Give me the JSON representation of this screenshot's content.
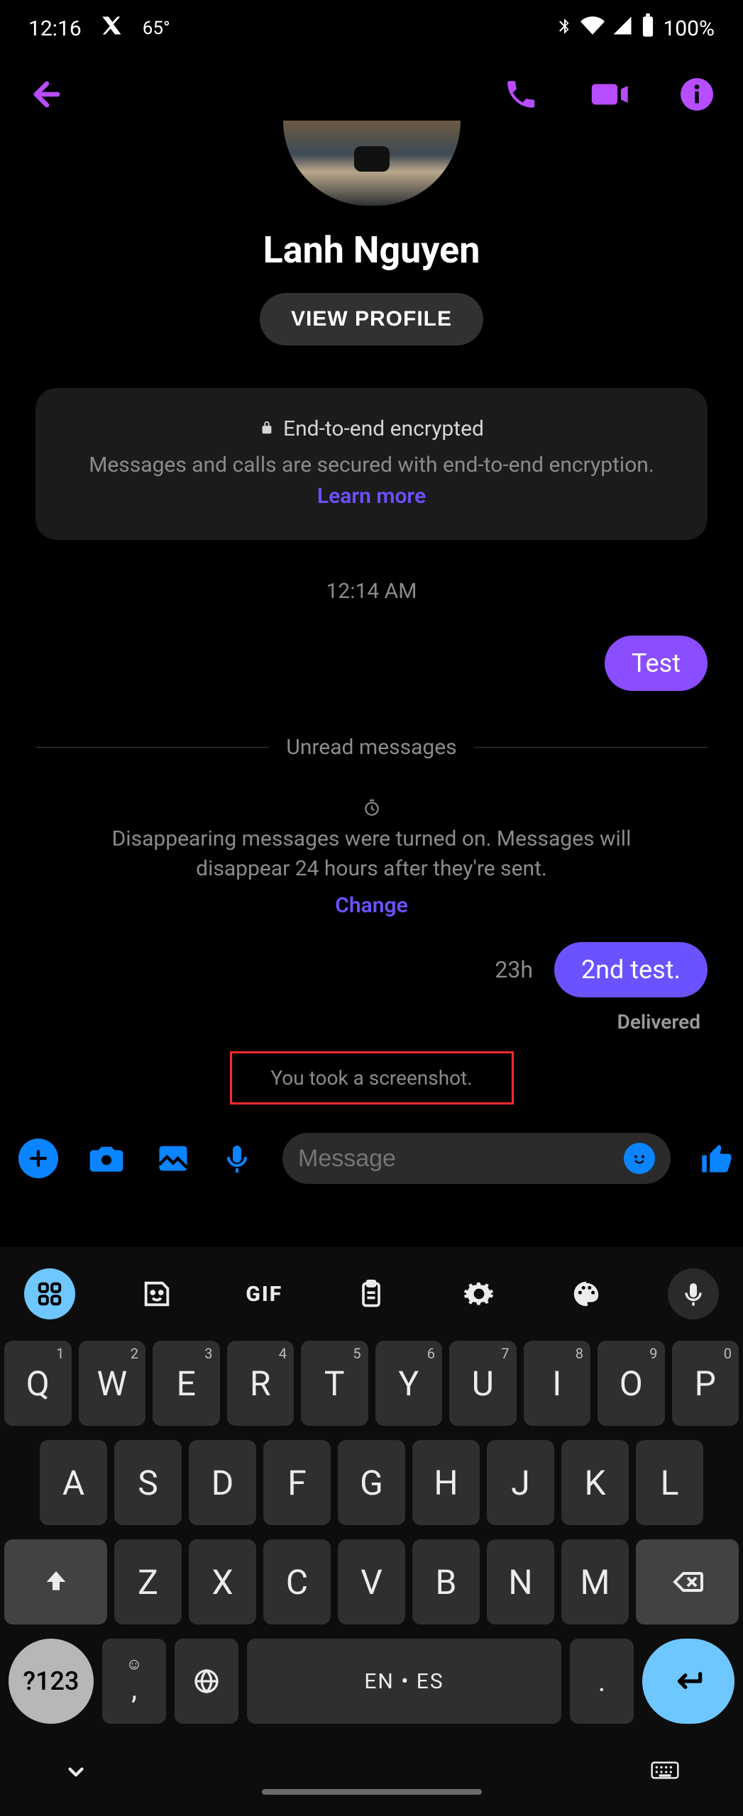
{
  "status": {
    "time": "12:16",
    "temp": "65°",
    "battery": "100%"
  },
  "chat": {
    "contact_name": "Lanh Nguyen",
    "view_profile": "VIEW PROFILE",
    "encrypt_title": "End-to-end encrypted",
    "encrypt_sub_before": "Messages and calls are secured with end-to-end encryption. ",
    "learn_more": "Learn more",
    "timestamp": "12:14 AM",
    "msg1": "Test",
    "unread_label": "Unread messages",
    "disappearing_text": "Disappearing messages were turned on. Messages will disappear 24 hours after they're sent. ",
    "change": "Change",
    "hours_ago": "23h",
    "msg2": "2nd test.",
    "delivered": "Delivered",
    "screenshot_note": "You took a screenshot."
  },
  "composer": {
    "placeholder": "Message"
  },
  "keyboard": {
    "gif": "GIF",
    "row1": [
      {
        "k": "Q",
        "n": "1"
      },
      {
        "k": "W",
        "n": "2"
      },
      {
        "k": "E",
        "n": "3"
      },
      {
        "k": "R",
        "n": "4"
      },
      {
        "k": "T",
        "n": "5"
      },
      {
        "k": "Y",
        "n": "6"
      },
      {
        "k": "U",
        "n": "7"
      },
      {
        "k": "I",
        "n": "8"
      },
      {
        "k": "O",
        "n": "9"
      },
      {
        "k": "P",
        "n": "0"
      }
    ],
    "row2": [
      "A",
      "S",
      "D",
      "F",
      "G",
      "H",
      "J",
      "K",
      "L"
    ],
    "row3": [
      "Z",
      "X",
      "C",
      "V",
      "B",
      "N",
      "M"
    ],
    "symbols": "?123",
    "space": "EN • ES",
    "comma": ",",
    "period": "."
  }
}
